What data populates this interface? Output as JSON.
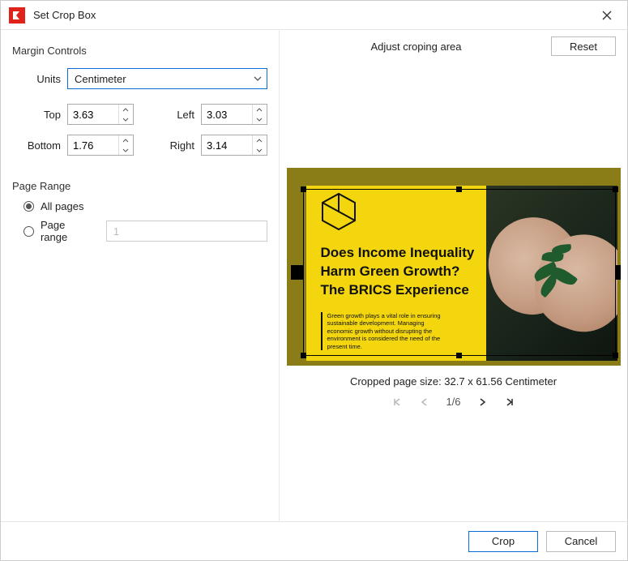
{
  "window": {
    "title": "Set Crop Box"
  },
  "sections": {
    "margin_controls": "Margin Controls",
    "page_range": "Page Range",
    "adjust": "Adjust croping area"
  },
  "units": {
    "label": "Units",
    "selected": "Centimeter"
  },
  "margins": {
    "top_label": "Top",
    "top_value": "3.63",
    "left_label": "Left",
    "left_value": "3.03",
    "bottom_label": "Bottom",
    "bottom_value": "1.76",
    "right_label": "Right",
    "right_value": "3.14"
  },
  "page_range": {
    "all_label": "All pages",
    "range_label": "Page range",
    "range_placeholder": "1",
    "selected": "all"
  },
  "buttons": {
    "reset": "Reset",
    "crop": "Crop",
    "cancel": "Cancel"
  },
  "preview": {
    "headline_l1": "Does Income Inequality",
    "headline_l2": "Harm Green Growth?",
    "headline_l3": "The BRICS Experience",
    "body": "Green growth plays a vital role in ensuring sustainable development. Managing economic growth without disrupting the environment is considered the need of the present time."
  },
  "status": {
    "cropped_size": "Cropped page size: 32.7 x 61.56 Centimeter",
    "page_indicator": "1/6"
  }
}
